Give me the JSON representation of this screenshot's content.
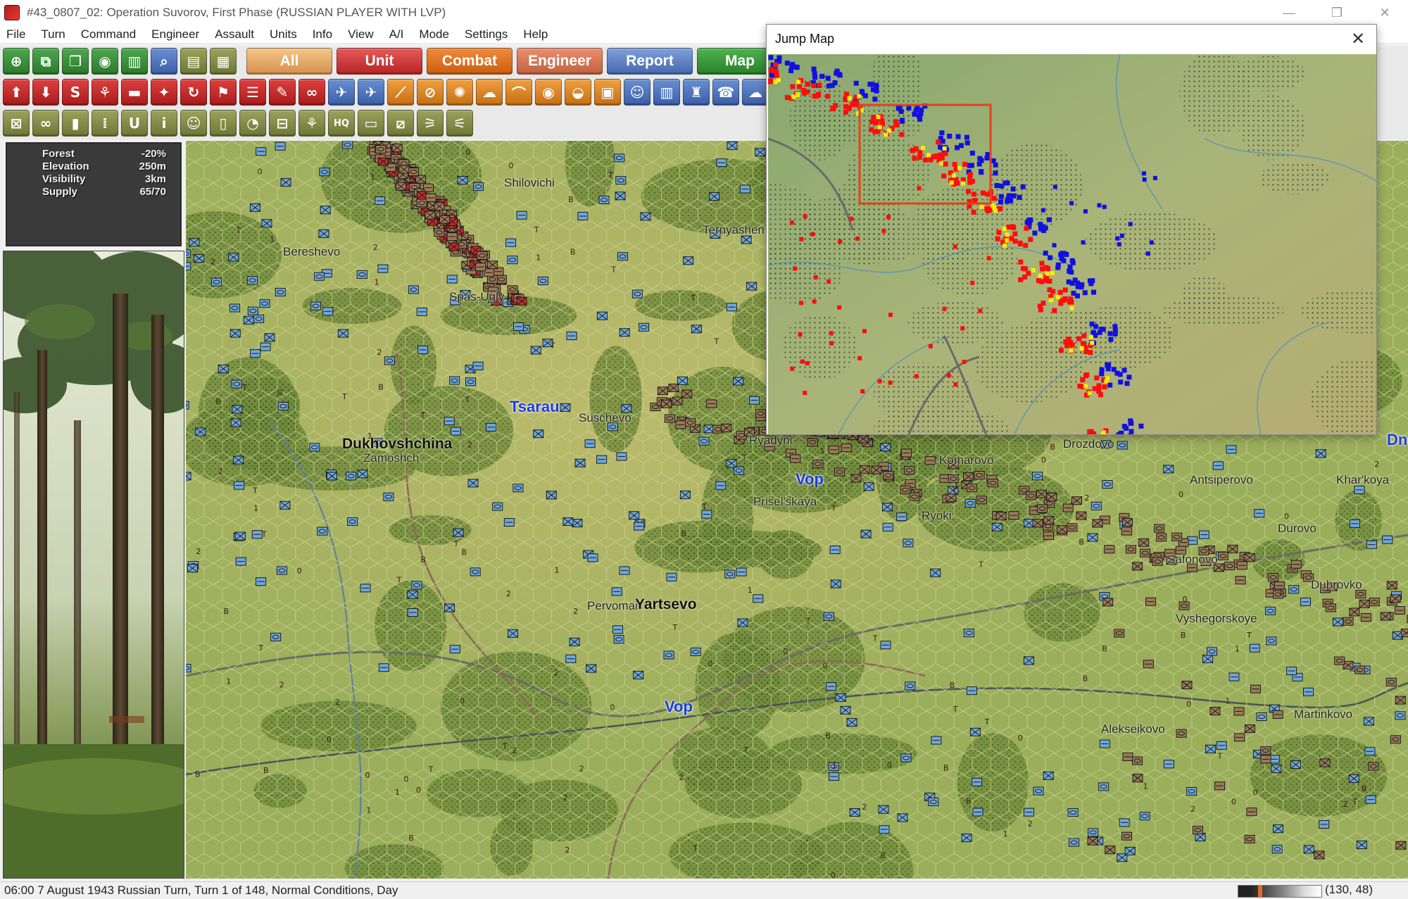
{
  "window": {
    "title": "#43_0807_02: Operation Suvorov, First Phase (RUSSIAN PLAYER WITH LVP)",
    "controls": {
      "minimize": "—",
      "restore": "❐",
      "close": "✕"
    }
  },
  "menu": [
    "File",
    "Turn",
    "Command",
    "Engineer",
    "Assault",
    "Units",
    "Info",
    "View",
    "A/I",
    "Mode",
    "Settings",
    "Help"
  ],
  "toolbar": {
    "row1_icons": [
      "crosshair-icon",
      "layers-icon",
      "copy-icon",
      "eye-icon",
      "map-fold-icon",
      "magnifier-icon",
      "report-icon",
      "document-icon"
    ],
    "tabs": [
      {
        "id": "all",
        "label": "All"
      },
      {
        "id": "unit",
        "label": "Unit"
      },
      {
        "id": "combat",
        "label": "Combat"
      },
      {
        "id": "engineer",
        "label": "Engineer"
      },
      {
        "id": "report",
        "label": "Report"
      },
      {
        "id": "map",
        "label": "Map"
      }
    ],
    "row2_icons": [
      {
        "name": "up-arrow-icon",
        "glyph": "⬆",
        "color": "red"
      },
      {
        "name": "down-arrow-icon",
        "glyph": "⬇",
        "color": "red"
      },
      {
        "name": "supply-s-icon",
        "glyph": "S",
        "color": "red"
      },
      {
        "name": "airborne-icon",
        "glyph": "⚘",
        "color": "red"
      },
      {
        "name": "tank-icon",
        "glyph": "▬",
        "color": "red"
      },
      {
        "name": "soldier-walk-icon",
        "glyph": "✦",
        "color": "red"
      },
      {
        "name": "refresh-icon",
        "glyph": "↻",
        "color": "red"
      },
      {
        "name": "flag-icon",
        "glyph": "⚑",
        "color": "red"
      },
      {
        "name": "list-icon",
        "glyph": "☰",
        "color": "red"
      },
      {
        "name": "pencil-icon",
        "glyph": "✎",
        "color": "red"
      },
      {
        "name": "binoculars-icon",
        "glyph": "∞",
        "color": "red"
      },
      {
        "name": "plane-icon",
        "glyph": "✈",
        "color": "blue"
      },
      {
        "name": "bomber-icon",
        "glyph": "✈",
        "color": "blue"
      },
      {
        "name": "artillery-icon",
        "glyph": "⟋",
        "color": "orange"
      },
      {
        "name": "no-fire-icon",
        "glyph": "⊘",
        "color": "orange"
      },
      {
        "name": "barrage-icon",
        "glyph": "✺",
        "color": "orange"
      },
      {
        "name": "smoke-icon",
        "glyph": "☁",
        "color": "orange"
      },
      {
        "name": "bridge-icon",
        "glyph": "⌒",
        "color": "orange"
      },
      {
        "name": "mine-icon",
        "glyph": "◉",
        "color": "orange"
      },
      {
        "name": "rubble-icon",
        "glyph": "◒",
        "color": "orange"
      },
      {
        "name": "fortify-icon",
        "glyph": "▣",
        "color": "orange"
      },
      {
        "name": "troops-icon",
        "glyph": "☺",
        "color": "blue"
      },
      {
        "name": "book-icon",
        "glyph": "▥",
        "color": "blue"
      },
      {
        "name": "trophy-icon",
        "glyph": "♜",
        "color": "blue"
      },
      {
        "name": "phone-icon",
        "glyph": "☎",
        "color": "blue"
      },
      {
        "name": "weather-cloud-icon",
        "glyph": "☁",
        "color": "blue"
      }
    ],
    "row3_icons": [
      {
        "name": "deselect-icon",
        "glyph": "⊠"
      },
      {
        "name": "link-icon",
        "glyph": "∞"
      },
      {
        "name": "lock-icon",
        "glyph": "▮"
      },
      {
        "name": "ammo-icon",
        "glyph": "⁞"
      },
      {
        "name": "u-icon",
        "glyph": "U"
      },
      {
        "name": "info-i-icon",
        "glyph": "i"
      },
      {
        "name": "face-icon",
        "glyph": "☺"
      },
      {
        "name": "fuel-icon",
        "glyph": "▯"
      },
      {
        "name": "pie-icon",
        "glyph": "◔"
      },
      {
        "name": "minus-box-icon",
        "glyph": "⊟"
      },
      {
        "name": "parachute-icon",
        "glyph": "⚘"
      },
      {
        "name": "hq-icon",
        "glyph": "HQ"
      },
      {
        "name": "unit-box-icon",
        "glyph": "▭"
      },
      {
        "name": "slash-box-icon",
        "glyph": "⧄"
      },
      {
        "name": "hierarchy-icon",
        "glyph": "⚞"
      },
      {
        "name": "tree-org-icon",
        "glyph": "⚟"
      }
    ]
  },
  "terrain_info": [
    {
      "label": "Forest",
      "value": "-20%"
    },
    {
      "label": "Elevation",
      "value": "250m"
    },
    {
      "label": "Visibility",
      "value": "3km"
    },
    {
      "label": "Supply",
      "value": "65/70"
    }
  ],
  "map_labels": [
    {
      "text": "Shilovichi",
      "style": "normal"
    },
    {
      "text": "Ternyashen",
      "style": "normal"
    },
    {
      "text": "Bereshevo",
      "style": "normal"
    },
    {
      "text": "Spas-Ugly",
      "style": "normal"
    },
    {
      "text": "Tsarau",
      "style": "blue"
    },
    {
      "text": "Suschevo",
      "style": "normal"
    },
    {
      "text": "Dukhovshchina",
      "style": "big"
    },
    {
      "text": "Zamoshch",
      "style": "normal"
    },
    {
      "text": "Ryadyni",
      "style": "normal"
    },
    {
      "text": "Vop",
      "style": "blue"
    },
    {
      "text": "Prisel'skaya",
      "style": "normal"
    },
    {
      "text": "Komarovo",
      "style": "normal"
    },
    {
      "text": "Drozdovo",
      "style": "normal"
    },
    {
      "text": "Ryoki",
      "style": "normal"
    },
    {
      "text": "Antsiperovo",
      "style": "normal"
    },
    {
      "text": "Khar'koya",
      "style": "normal"
    },
    {
      "text": "Durovo",
      "style": "normal"
    },
    {
      "text": "Safonovo",
      "style": "normal"
    },
    {
      "text": "Dubrovko",
      "style": "normal"
    },
    {
      "text": "Pervomai",
      "style": "normal"
    },
    {
      "text": "Yartsevo",
      "style": "big"
    },
    {
      "text": "Vyshegorskoye",
      "style": "normal"
    },
    {
      "text": "Vop",
      "style": "blue"
    },
    {
      "text": "Alekseikovo",
      "style": "normal"
    },
    {
      "text": "Martinkovo",
      "style": "normal"
    },
    {
      "text": "Dne",
      "style": "blue"
    }
  ],
  "jump_map": {
    "title": "Jump Map",
    "close_glyph": "✕",
    "colors": {
      "soviet": "#1010e0",
      "german": "#ff0d0d",
      "highlight": "#ffee00",
      "viewport_box": "#e0441a"
    }
  },
  "status": {
    "text": "06:00 7 August 1943 Russian Turn, Turn 1 of 148, Normal Conditions, Day",
    "coords": "(130, 48)"
  },
  "colors": {
    "map_base": "#9aae5c",
    "hex_grid": "#c9d48e",
    "german_counter": "#9a7a56",
    "soviet_counter": "#6fa7d8",
    "red_counter": "#c22b2b"
  }
}
